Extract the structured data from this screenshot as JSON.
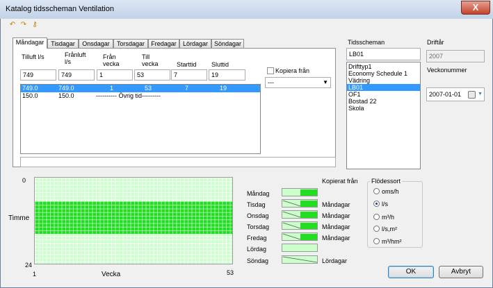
{
  "window": {
    "title": "Katalog tidsscheman Ventilation",
    "close_label": "X"
  },
  "toolbar": {
    "icons": [
      "undo-icon",
      "redo-icon",
      "key-icon"
    ]
  },
  "tabs": [
    {
      "label": "Måndagar"
    },
    {
      "label": "Tisdagar"
    },
    {
      "label": "Onsdagar"
    },
    {
      "label": "Torsdagar"
    },
    {
      "label": "Fredagar"
    },
    {
      "label": "Lördagar"
    },
    {
      "label": "Söndagar"
    }
  ],
  "form": {
    "headers": {
      "tilluft": "Tilluft l/s",
      "franluft": "Frånluft l/s",
      "fran_vecka": "Från vecka",
      "till_vecka": "Till vecka",
      "starttid": "Starttid",
      "sluttid": "Sluttid"
    },
    "values": {
      "tilluft": "749",
      "franluft": "749",
      "fran_vecka": "1",
      "till_vecka": "53",
      "starttid": "7",
      "sluttid": "19"
    },
    "kopiera_label": "Kopiera från",
    "kopiera_value": "---"
  },
  "periods": [
    {
      "tilluft": "749.0",
      "franluft": "749.0",
      "fran": "1",
      "till": "53",
      "start": "7",
      "slut": "19",
      "selected": true
    },
    {
      "tilluft": "150.0",
      "franluft": "150.0",
      "note": "---------- Övrig tid---------",
      "selected": false
    }
  ],
  "right": {
    "tidsscheman_label": "Tidsscheman",
    "tidsscheman_value": "LB01",
    "schedules": [
      "Drifttyp1",
      "Economy Schedule 1",
      "Vädring",
      "LB01",
      "OF1",
      "Bostad 22",
      "Skola"
    ],
    "selected_index": 3,
    "driftar_label": "Driftår",
    "driftar_value": "2007",
    "veckonummer_label": "Veckonummer",
    "date_value": "2007-01-01"
  },
  "chart": {
    "y_top": "0",
    "y_bottom": "24",
    "y_label": "Timme",
    "x_left": "1",
    "x_right": "53",
    "x_label": "Vecka",
    "band_start_hour": 7,
    "band_end_hour": 19
  },
  "copy": {
    "header": "Kopierat från",
    "days": [
      {
        "day": "Måndag",
        "from": ""
      },
      {
        "day": "Tisdag",
        "from": "Måndagar"
      },
      {
        "day": "Onsdag",
        "from": "Måndagar"
      },
      {
        "day": "Torsdag",
        "from": "Måndagar"
      },
      {
        "day": "Fredag",
        "from": "Måndagar"
      },
      {
        "day": "Lördag",
        "from": ""
      },
      {
        "day": "Söndag",
        "from": "Lördagar"
      }
    ]
  },
  "flodessort": {
    "label": "Flödessort",
    "options": [
      "oms/h",
      "l/s",
      "m³/h",
      "l/s,m²",
      "m³/hm²"
    ],
    "selected": "l/s"
  },
  "buttons": {
    "ok": "OK",
    "cancel": "Avbryt"
  }
}
